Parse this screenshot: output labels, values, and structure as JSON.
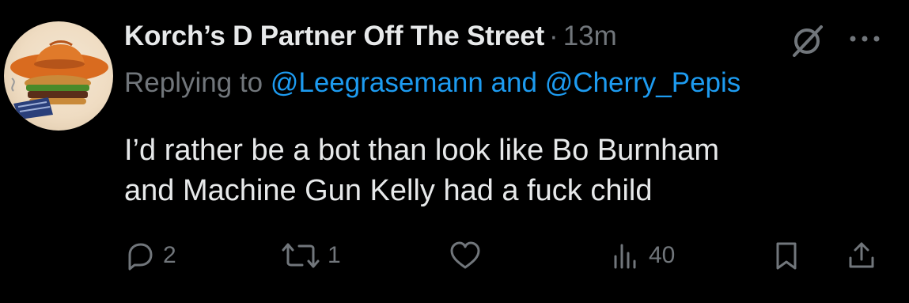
{
  "tweet": {
    "author_name": "Korch’s D Partner Off The Street",
    "separator": "·",
    "time": "13m",
    "replying_prefix": "Replying to ",
    "mention_1": "@Leegrasemann",
    "mention_joiner": " and ",
    "mention_2": "@Cherry_Pepis",
    "text": "I’d rather be a bot than look like Bo Burnham\nand Machine Gun Kelly had a fuck child"
  },
  "actions": {
    "reply_count": "2",
    "retweet_count": "1",
    "like_count": "",
    "views_count": "40"
  },
  "icons": {
    "avatar": "cowboy-hat-burger-avatar",
    "grok": "grok-slash-circle-icon",
    "more": "more-dots-icon",
    "reply": "speech-bubble-icon",
    "retweet": "retweet-arrows-icon",
    "like": "heart-icon",
    "views": "bar-chart-icon",
    "bookmark": "bookmark-icon",
    "share": "share-upload-icon"
  },
  "colors": {
    "background": "#000000",
    "primary_text": "#e7e9ea",
    "secondary_text": "#71767b",
    "link": "#1d9bf0"
  }
}
